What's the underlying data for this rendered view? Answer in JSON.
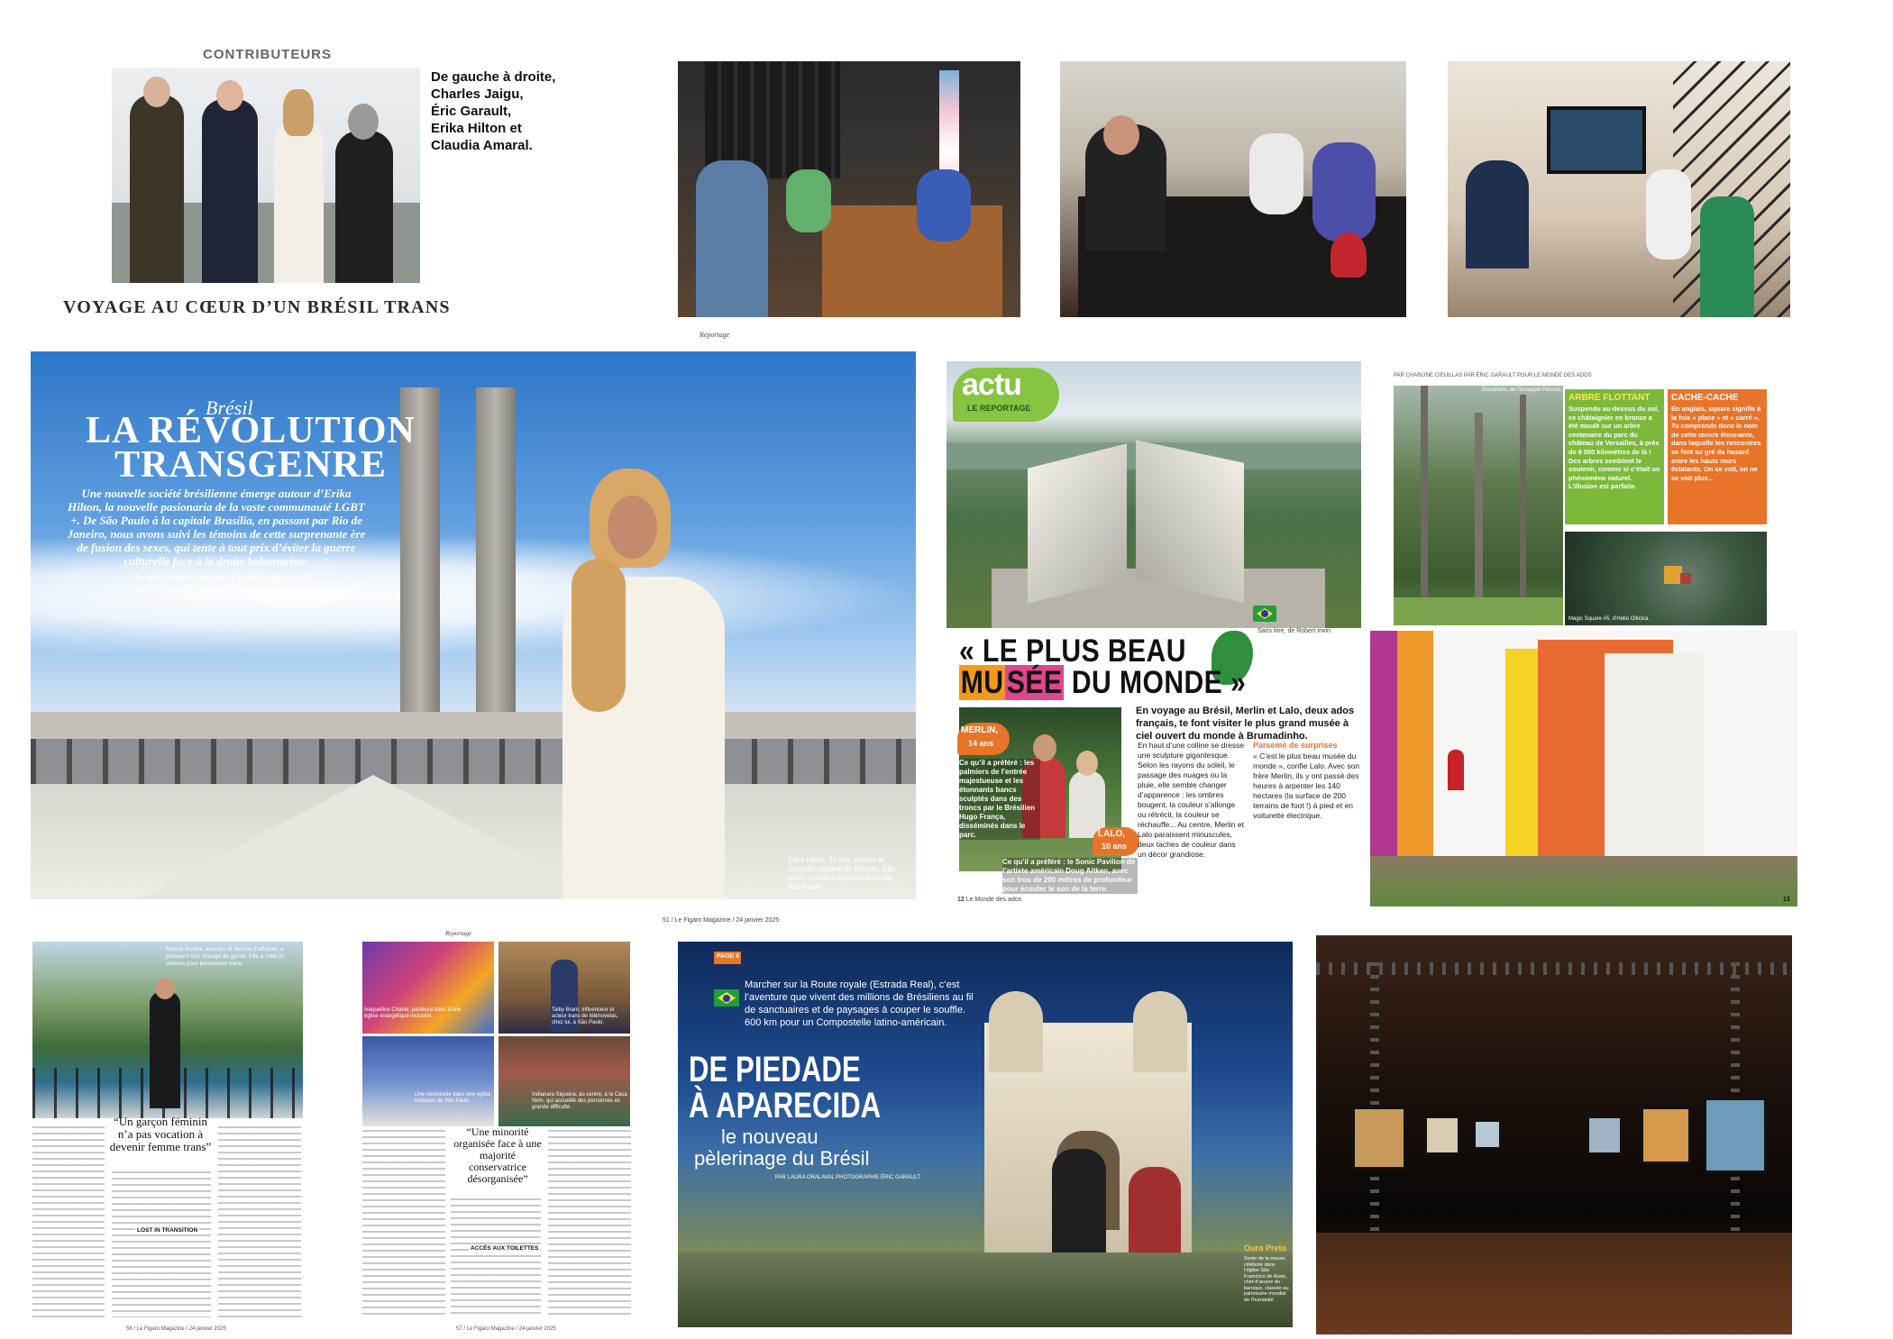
{
  "page1": {
    "section_label": "CONTRIBUTEURS",
    "contributors_caption": "De gauche à droite,\nCharles Jaigu,\nÉric Garault,\nErika Hilton et\nClaudia Amaral.",
    "headline": "VOYAGE AU CŒUR D’UN BRÉSIL TRANS",
    "reportage_label": "Reportage"
  },
  "spread1": {
    "kicker": "Brésil",
    "title_line1": "LA RÉVOLUTION",
    "title_line2": "TRANSGENRE",
    "intro": "Une nouvelle société brésilienne émerge autour d’Erika Hilton, la nouvelle pasionaria de la vaste communauté LGBT +. De São Paulo à la capitale Brasília, en passant par Rio de Janeiro, nous avons suivi les témoins de cette surprenante ère de fusion des sexes, qui tente à tout prix d’éviter la guerre culturelle face à la droite bolsonariste.",
    "byline": "De nos envoyés spéciaux Charles Jaigu (texte)\net Éric Garault (photos)",
    "photo_caption": "Erika Hilton, 31 ans, devant le Congrès national de Brasília. Elle est la première députée trans de São Paulo.",
    "folio": "51 / Le Figaro Magazine / 24 janvier 2025"
  },
  "actu": {
    "badge": "actu",
    "badge_sub": "LE REPORTAGE",
    "photo_credit": "Sans titre, de Robert Irwin.",
    "title_part1": "« LE PLUS BEAU",
    "title_part2a": "MU",
    "title_part2b": "SÉE",
    "title_part2c": " DU MONDE »",
    "standfirst": "En voyage au Brésil, Merlin et Lalo, deux ados français, te font visiter le plus grand musée à ciel ouvert du monde à Brumadinho.",
    "merlin_name": "MERLIN,",
    "merlin_age": "14 ans",
    "merlin_text": "Ce qu’il a préféré : les palmiers de l’entrée majestueuse et les étonnants bancs sculptés dans des troncs par le Brésilien Hugo França, disséminés dans le parc.",
    "lalo_name": "LALO,",
    "lalo_age": "10 ans",
    "lalo_text": "Ce qu’il a préféré : le Sonic Pavilion de l’artiste américain Doug Aitken, avec son trou de 200 mètres de profondeur pour écouter le son de la terre.",
    "col1_text": "En haut d’une colline se dresse une sculpture gigantesque. Selon les rayons du soleil, le passage des nuages ou la pluie, elle semble changer d’apparence : les ombres bougent, la couleur s’allonge ou rétrécit, la couleur se réchauffe... Au centre, Merlin et Lalo paraissent minuscules, deux taches de couleur dans un décor grandiose.",
    "col2_heading": "Parsemé de surprises",
    "col2_text": "« C’est le plus beau musée du monde », confie Lalo. Avec son frère Merlin, ils y ont passé des heures à arpenter les 140 hectares (la surface de 200 terrains de foot !) à pied et en voiturette électrique.",
    "page_num_left": "12",
    "publication": "Le Monde des ados",
    "credits": "PAR CHARLINE CIEUILLAS  PAR ÉRIC GARAULT POUR LE MONDE DES ADOS",
    "caption_trees": "Elevations, de Giuseppe Penone.",
    "box1_title": "ARBRE FLOTTANT",
    "box1_text": "Suspendu au-dessus du sol, ce châtaignier en bronze a été moulé sur un arbre centenaire du parc du château de Versailles, à près de 9 000 kilomètres de là ! Des arbres semblent le soutenir, comme si c’était un phénomène naturel. L’illusion est parfaite.",
    "box2_title": "CACHE-CACHE",
    "box2_text": "En anglais, square signifie à la fois « place » et « carré ». Tu comprends donc le nom de cette œuvre étonnante, dans laquelle les rencontres se font au gré du hasard entre les hauts murs éclatants. On se voit, on ne se voit plus...",
    "caption_aerial": "Magic Square #5, d’Helio Oiticica.",
    "page_num_right": "13"
  },
  "spread2": {
    "reportage_label": "Reportage",
    "caption_top": "Marcia Rocha, avocate et femme d’affaires, a plusieurs fois changé de genre. Elle a créé un cinéma pour personnes trans.",
    "caption_mid1": "Ivaquelline Chanel, pasteure trans d’une église évangélique inclusive.",
    "caption_mid2": "Taiby Brant, influenceur et acteur trans de télénovelas, chez lui, à São Paulo.",
    "caption_mid3": "Une cérémonie dans une église inclusive de São Paulo.",
    "caption_mid4": "Indianara Siqueira, au centre, à la Casa Nem, qui accueille des personnes en grande difficulté.",
    "quote1": "“Un garçon féminin n’a pas vocation à devenir femme trans”",
    "quote2": "“Une minorité organisée face à une majorité conservatrice désorganisée”",
    "subhead1": "LOST IN TRANSITION",
    "subhead2": "ACCÈS AUX TOILETTES",
    "folio_left": "56 / Le Figaro Magazine / 24 janvier 2025",
    "folio_right": "57 / Le Figaro Magazine / 24 janvier 2025"
  },
  "spread3": {
    "tag": "PAGE 6",
    "intro": "Marcher sur la Route royale (Estrada Real), c’est l’aventure que vivent des millions de Brésiliens au fil de sanctuaires et de paysages à couper le souffle. 600 km pour un Compostelle latino-américain.",
    "title_line1": "DE PIEDADE",
    "title_line2": "À APARECIDA",
    "subtitle_line1": "le nouveau",
    "subtitle_line2": "pèlerinage du Brésil",
    "byline": "PAR LAURA ORALAVAL  PHOTOGRAPHIE ÉRIC GARAULT",
    "place": "Ouro Preto",
    "place_caption": "Sortie de la messe, célébrée dans l’église São Francisco de Assis, chef-d’œuvre du baroque, classée au patrimoine mondial de l’humanité."
  }
}
